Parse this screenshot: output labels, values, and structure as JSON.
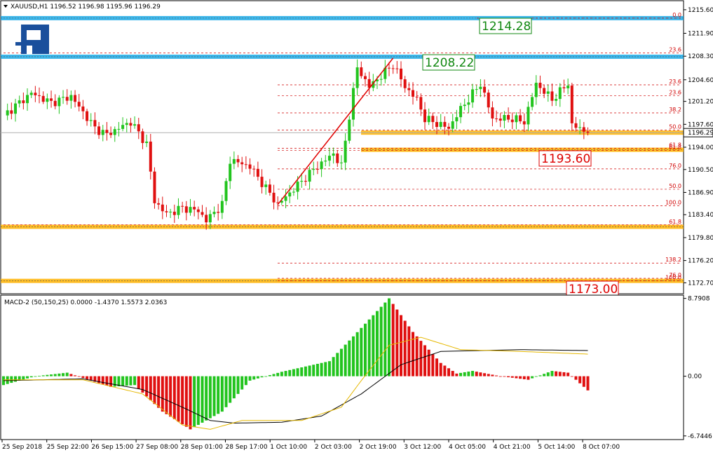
{
  "header": {
    "symbol_line": "XAUUSD,H1  1196.52 1196.98 1195.96 1196.29",
    "macd_line": "MACD-2 (50,150,25) 0.0000 -1.4370 1.5573 2.0363"
  },
  "current_price": "1196.29",
  "colors": {
    "bull": "#22c41e",
    "bear": "#e01010",
    "level_blue": "#1aa9e6",
    "level_orange": "#ffb300",
    "fib": "#d00000",
    "signal": "#e6b800",
    "macd_line": "#000000",
    "label_green": "#118811",
    "label_red": "#dd0000"
  },
  "chart_data": [
    {
      "type": "candlestick",
      "title": "XAUUSD,H1",
      "price_axis": {
        "ylim": [
          1171.2,
          1216.8
        ],
        "ticks": [
          "1215.60",
          "1211.90",
          "1208.30",
          "1204.60",
          "1201.20",
          "1197.60",
          "1194.00",
          "1190.50",
          "1186.90",
          "1183.40",
          "1179.80",
          "1176.20",
          "1172.70"
        ]
      },
      "time_axis": {
        "labels": [
          "25 Sep 2018",
          "25 Sep 22:00",
          "26 Sep 15:00",
          "27 Sep 08:00",
          "28 Sep 01:00",
          "28 Sep 17:00",
          "1 Oct 10:00",
          "2 Oct 03:00",
          "2 Oct 19:00",
          "3 Oct 12:00",
          "4 Oct 05:00",
          "4 Oct 21:00",
          "5 Oct 14:00",
          "8 Oct 07:00"
        ]
      },
      "key_levels": [
        {
          "price": 1214.28,
          "label": "1214.28",
          "color": "blue"
        },
        {
          "price": 1208.22,
          "label": "1208.22",
          "color": "blue"
        },
        {
          "price": 1196.29,
          "label": "",
          "color": "orange"
        },
        {
          "price": 1193.6,
          "label": "1193.60",
          "color": "orange"
        },
        {
          "price": 1181.5,
          "label": "",
          "color": "orange"
        },
        {
          "price": 1173.0,
          "label": "1173.00",
          "color": "orange"
        }
      ],
      "fib_levels": [
        {
          "label": "0.0",
          "price": 1214.28
        },
        {
          "label": "23.6",
          "price": 1208.8
        },
        {
          "label": "23.6",
          "price": 1203.8
        },
        {
          "label": "23.6",
          "price": 1202.1
        },
        {
          "label": "38.2",
          "price": 1199.4
        },
        {
          "label": "50.0",
          "price": 1196.7
        },
        {
          "label": "61.8",
          "price": 1193.85
        },
        {
          "label": "61.8",
          "price": 1193.5
        },
        {
          "label": "76.0",
          "price": 1190.6
        },
        {
          "label": "50.0",
          "price": 1187.4
        },
        {
          "label": "100.0",
          "price": 1184.8
        },
        {
          "label": "61.8",
          "price": 1181.8
        },
        {
          "label": "138.2",
          "price": 1175.8
        },
        {
          "label": "76.0",
          "price": 1173.4
        },
        {
          "label": "100.0",
          "price": 1173.0
        }
      ],
      "trend_line": {
        "from": {
          "bar": 69,
          "price": 1185.0
        },
        "to": {
          "bar": 98,
          "price": 1208.0
        }
      },
      "keypoints": [
        {
          "bar": 0,
          "price": 1199.0
        },
        {
          "bar": 7,
          "price": 1202.5
        },
        {
          "bar": 12,
          "price": 1201.0
        },
        {
          "bar": 17,
          "price": 1202.0
        },
        {
          "bar": 23,
          "price": 1197.0
        },
        {
          "bar": 26,
          "price": 1196.0
        },
        {
          "bar": 32,
          "price": 1198.0
        },
        {
          "bar": 36,
          "price": 1194.5
        },
        {
          "bar": 38,
          "price": 1185.5
        },
        {
          "bar": 41,
          "price": 1183.5
        },
        {
          "bar": 45,
          "price": 1184.5
        },
        {
          "bar": 49,
          "price": 1184.0
        },
        {
          "bar": 51,
          "price": 1182.5
        },
        {
          "bar": 55,
          "price": 1185.0
        },
        {
          "bar": 57,
          "price": 1192.0
        },
        {
          "bar": 62,
          "price": 1191.0
        },
        {
          "bar": 69,
          "price": 1185.0
        },
        {
          "bar": 78,
          "price": 1190.5
        },
        {
          "bar": 83,
          "price": 1193.0
        },
        {
          "bar": 85,
          "price": 1191.0
        },
        {
          "bar": 87,
          "price": 1199.0
        },
        {
          "bar": 89,
          "price": 1206.5
        },
        {
          "bar": 92,
          "price": 1203.5
        },
        {
          "bar": 98,
          "price": 1207.0
        },
        {
          "bar": 101,
          "price": 1203.5
        },
        {
          "bar": 104,
          "price": 1201.5
        },
        {
          "bar": 106,
          "price": 1198.5
        },
        {
          "bar": 112,
          "price": 1197.0
        },
        {
          "bar": 115,
          "price": 1200.0
        },
        {
          "bar": 120,
          "price": 1204.0
        },
        {
          "bar": 123,
          "price": 1198.5
        },
        {
          "bar": 128,
          "price": 1198.5
        },
        {
          "bar": 131,
          "price": 1198.0
        },
        {
          "bar": 134,
          "price": 1204.0
        },
        {
          "bar": 138,
          "price": 1201.5
        },
        {
          "bar": 142,
          "price": 1204.0
        },
        {
          "bar": 143,
          "price": 1197.5
        },
        {
          "bar": 147,
          "price": 1196.3
        }
      ]
    },
    {
      "type": "bar",
      "title": "MACD-2 (50,150,25)",
      "value_axis": {
        "ylim": [
          -7.0,
          9.0
        ],
        "ticks": [
          "8.7908",
          "0.00",
          "-6.7446"
        ]
      },
      "histogram_keypoints": [
        {
          "bar": 0,
          "value": -1.0
        },
        {
          "bar": 8,
          "value": 0.0
        },
        {
          "bar": 16,
          "value": 0.4
        },
        {
          "bar": 20,
          "value": -0.2
        },
        {
          "bar": 27,
          "value": -1.2
        },
        {
          "bar": 33,
          "value": -1.0
        },
        {
          "bar": 40,
          "value": -4.0
        },
        {
          "bar": 47,
          "value": -6.0
        },
        {
          "bar": 55,
          "value": -4.0
        },
        {
          "bar": 62,
          "value": -0.5
        },
        {
          "bar": 70,
          "value": 0.5
        },
        {
          "bar": 82,
          "value": 1.7
        },
        {
          "bar": 88,
          "value": 4.5
        },
        {
          "bar": 97,
          "value": 8.8
        },
        {
          "bar": 103,
          "value": 5.0
        },
        {
          "bar": 110,
          "value": 1.5
        },
        {
          "bar": 114,
          "value": 0.3
        },
        {
          "bar": 118,
          "value": 0.6
        },
        {
          "bar": 125,
          "value": 0.0
        },
        {
          "bar": 132,
          "value": -0.4
        },
        {
          "bar": 138,
          "value": 0.6
        },
        {
          "bar": 142,
          "value": 0.4
        },
        {
          "bar": 147,
          "value": -1.6
        }
      ],
      "macd_line_keypoints": [
        {
          "bar": 0,
          "value": -0.5
        },
        {
          "bar": 20,
          "value": -0.3
        },
        {
          "bar": 35,
          "value": -1.5
        },
        {
          "bar": 45,
          "value": -3.5
        },
        {
          "bar": 52,
          "value": -5.0
        },
        {
          "bar": 58,
          "value": -5.3
        },
        {
          "bar": 70,
          "value": -5.2
        },
        {
          "bar": 80,
          "value": -4.5
        },
        {
          "bar": 90,
          "value": -2.0
        },
        {
          "bar": 100,
          "value": 1.3
        },
        {
          "bar": 110,
          "value": 2.8
        },
        {
          "bar": 130,
          "value": 3.0
        },
        {
          "bar": 147,
          "value": 2.9
        }
      ],
      "signal_keypoints": [
        {
          "bar": 0,
          "value": -0.4
        },
        {
          "bar": 20,
          "value": -0.4
        },
        {
          "bar": 35,
          "value": -2.0
        },
        {
          "bar": 45,
          "value": -5.5
        },
        {
          "bar": 52,
          "value": -6.0
        },
        {
          "bar": 60,
          "value": -5.0
        },
        {
          "bar": 75,
          "value": -5.0
        },
        {
          "bar": 85,
          "value": -3.5
        },
        {
          "bar": 90,
          "value": -0.5
        },
        {
          "bar": 97,
          "value": 3.5
        },
        {
          "bar": 105,
          "value": 4.4
        },
        {
          "bar": 115,
          "value": 3.0
        },
        {
          "bar": 130,
          "value": 2.8
        },
        {
          "bar": 147,
          "value": 2.5
        }
      ]
    }
  ]
}
